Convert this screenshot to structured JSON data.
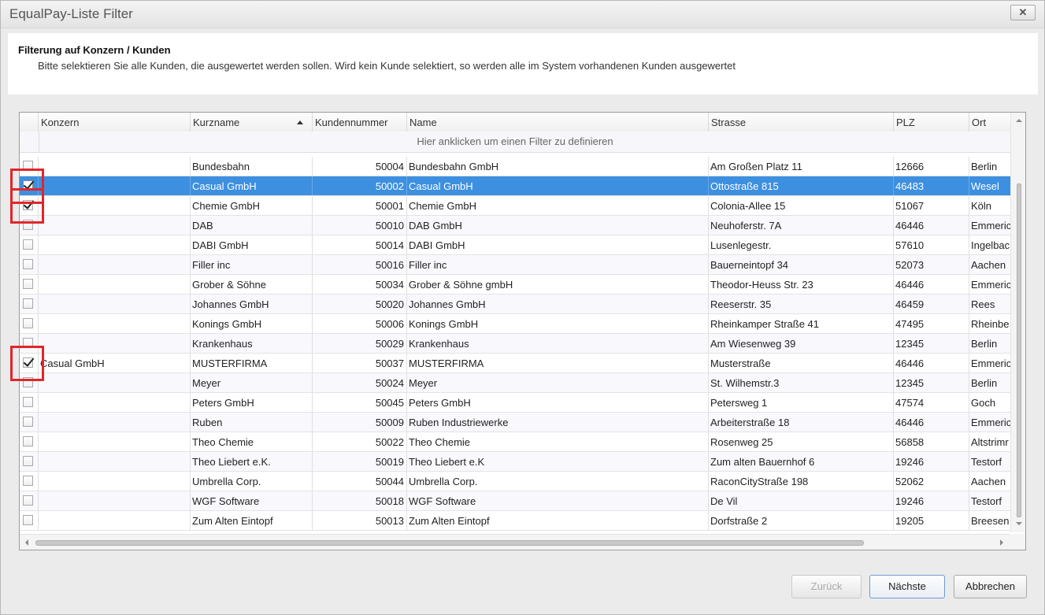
{
  "window": {
    "title": "EqualPay-Liste Filter",
    "close_label": "✕"
  },
  "header": {
    "title": "Filterung auf Konzern / Kunden",
    "subtitle": "Bitte selektieren Sie alle Kunden, die ausgewertet werden sollen. Wird kein Kunde selektiert, so werden alle im System vorhandenen Kunden ausgewertet"
  },
  "grid": {
    "columns": [
      "Konzern",
      "Kurzname",
      "Kundennummer",
      "Name",
      "Strasse",
      "PLZ",
      "Ort"
    ],
    "sort_column": "Kurzname",
    "sort_direction": "ascending",
    "filter_hint": "Hier anklicken um einen Filter zu definieren",
    "rows": [
      {
        "checked": false,
        "konzern": "",
        "kurzname": "Bundesbahn",
        "kundennummer": "50004",
        "name": "Bundesbahn GmbH",
        "strasse": "Am Großen Platz 11",
        "plz": "12666",
        "ort": "Berlin"
      },
      {
        "checked": true,
        "konzern": "",
        "kurzname": "Casual GmbH",
        "kundennummer": "50002",
        "name": "Casual GmbH",
        "strasse": "Ottostraße 815",
        "plz": "46483",
        "ort": "Wesel"
      },
      {
        "checked": true,
        "konzern": "",
        "kurzname": "Chemie GmbH",
        "kundennummer": "50001",
        "name": "Chemie GmbH",
        "strasse": "Colonia-Allee 15",
        "plz": "51067",
        "ort": "Köln"
      },
      {
        "checked": false,
        "konzern": "",
        "kurzname": "DAB",
        "kundennummer": "50010",
        "name": "DAB GmbH",
        "strasse": "Neuhoferstr. 7A",
        "plz": "46446",
        "ort": "Emmeric"
      },
      {
        "checked": false,
        "konzern": "",
        "kurzname": "DABI GmbH",
        "kundennummer": "50014",
        "name": "DABI GmbH",
        "strasse": "Lusenlegestr.",
        "plz": "57610",
        "ort": "Ingelbac"
      },
      {
        "checked": false,
        "konzern": "",
        "kurzname": "Filler inc",
        "kundennummer": "50016",
        "name": "Filler inc",
        "strasse": "Bauerneintopf 34",
        "plz": "52073",
        "ort": "Aachen"
      },
      {
        "checked": false,
        "konzern": "",
        "kurzname": "Grober & Söhne",
        "kundennummer": "50034",
        "name": "Grober & Söhne gmbH",
        "strasse": "Theodor-Heuss Str. 23",
        "plz": "46446",
        "ort": "Emmeric"
      },
      {
        "checked": false,
        "konzern": "",
        "kurzname": "Johannes GmbH",
        "kundennummer": "50020",
        "name": "Johannes GmbH",
        "strasse": "Reeserstr. 35",
        "plz": "46459",
        "ort": "Rees"
      },
      {
        "checked": false,
        "konzern": "",
        "kurzname": "Konings GmbH",
        "kundennummer": "50006",
        "name": "Konings GmbH",
        "strasse": "Rheinkamper Straße 41",
        "plz": "47495",
        "ort": "Rheinbe"
      },
      {
        "checked": false,
        "konzern": "",
        "kurzname": "Krankenhaus",
        "kundennummer": "50029",
        "name": "Krankenhaus",
        "strasse": "Am Wiesenweg 39",
        "plz": "12345",
        "ort": "Berlin"
      },
      {
        "checked": true,
        "konzern": "Casual GmbH",
        "kurzname": "MUSTERFIRMA",
        "kundennummer": "50037",
        "name": "MUSTERFIRMA",
        "strasse": "Musterstraße",
        "plz": "46446",
        "ort": "Emmeric"
      },
      {
        "checked": false,
        "konzern": "",
        "kurzname": "Meyer",
        "kundennummer": "50024",
        "name": "Meyer",
        "strasse": "St. Wilhemstr.3",
        "plz": "12345",
        "ort": "Berlin"
      },
      {
        "checked": false,
        "konzern": "",
        "kurzname": "Peters GmbH",
        "kundennummer": "50045",
        "name": "Peters GmbH",
        "strasse": "Petersweg 1",
        "plz": "47574",
        "ort": "Goch"
      },
      {
        "checked": false,
        "konzern": "",
        "kurzname": "Ruben",
        "kundennummer": "50009",
        "name": "Ruben Industriewerke",
        "strasse": "Arbeiterstraße 18",
        "plz": "46446",
        "ort": "Emmeric"
      },
      {
        "checked": false,
        "konzern": "",
        "kurzname": "Theo Chemie",
        "kundennummer": "50022",
        "name": "Theo Chemie",
        "strasse": "Rosenweg 25",
        "plz": "56858",
        "ort": "Altstrimr"
      },
      {
        "checked": false,
        "konzern": "",
        "kurzname": "Theo Liebert e.K.",
        "kundennummer": "50019",
        "name": "Theo Liebert e.K",
        "strasse": "Zum alten Bauernhof 6",
        "plz": "19246",
        "ort": "Testorf"
      },
      {
        "checked": false,
        "konzern": "",
        "kurzname": "Umbrella Corp.",
        "kundennummer": "50044",
        "name": "Umbrella Corp.",
        "strasse": "RaconCityStraße 198",
        "plz": "52062",
        "ort": "Aachen"
      },
      {
        "checked": false,
        "konzern": "",
        "kurzname": "WGF Software",
        "kundennummer": "50018",
        "name": "WGF Software",
        "strasse": "De Vil",
        "plz": "19246",
        "ort": "Testorf"
      },
      {
        "checked": false,
        "konzern": "",
        "kurzname": "Zum Alten Eintopf",
        "kundennummer": "50013",
        "name": "Zum Alten Eintopf",
        "strasse": "Dorfstraße 2",
        "plz": "19205",
        "ort": "Breesen"
      }
    ],
    "selected_row": 1,
    "highlighted_rows": [
      1,
      2,
      10
    ],
    "highlight_color": "#e0262a",
    "selection_color": "#3d8fe0"
  },
  "buttons": {
    "back": "Zurück",
    "next": "Nächste",
    "cancel": "Abbrechen"
  }
}
